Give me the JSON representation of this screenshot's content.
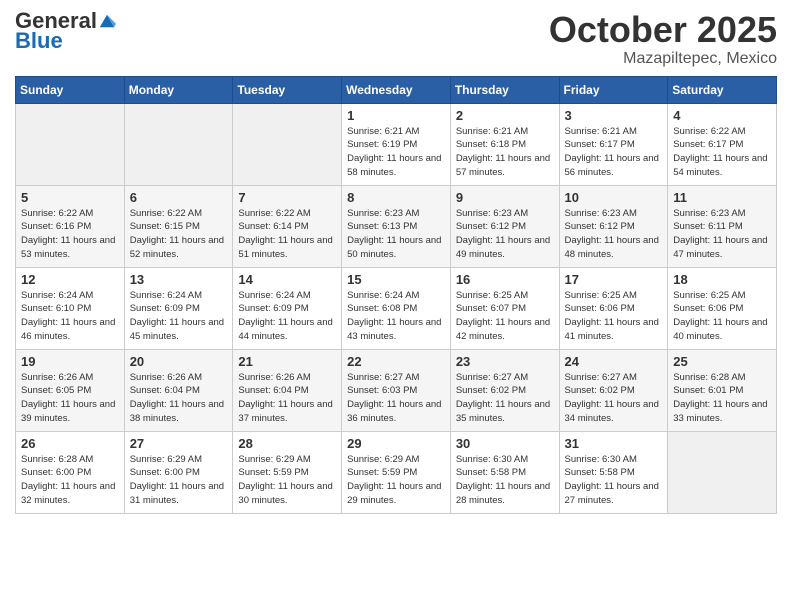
{
  "logo": {
    "general": "General",
    "blue": "Blue"
  },
  "header": {
    "month": "October 2025",
    "location": "Mazapiltepec, Mexico"
  },
  "weekdays": [
    "Sunday",
    "Monday",
    "Tuesday",
    "Wednesday",
    "Thursday",
    "Friday",
    "Saturday"
  ],
  "weeks": [
    [
      {
        "day": "",
        "sunrise": "",
        "sunset": "",
        "daylight": ""
      },
      {
        "day": "",
        "sunrise": "",
        "sunset": "",
        "daylight": ""
      },
      {
        "day": "",
        "sunrise": "",
        "sunset": "",
        "daylight": ""
      },
      {
        "day": "1",
        "sunrise": "Sunrise: 6:21 AM",
        "sunset": "Sunset: 6:19 PM",
        "daylight": "Daylight: 11 hours and 58 minutes."
      },
      {
        "day": "2",
        "sunrise": "Sunrise: 6:21 AM",
        "sunset": "Sunset: 6:18 PM",
        "daylight": "Daylight: 11 hours and 57 minutes."
      },
      {
        "day": "3",
        "sunrise": "Sunrise: 6:21 AM",
        "sunset": "Sunset: 6:17 PM",
        "daylight": "Daylight: 11 hours and 56 minutes."
      },
      {
        "day": "4",
        "sunrise": "Sunrise: 6:22 AM",
        "sunset": "Sunset: 6:17 PM",
        "daylight": "Daylight: 11 hours and 54 minutes."
      }
    ],
    [
      {
        "day": "5",
        "sunrise": "Sunrise: 6:22 AM",
        "sunset": "Sunset: 6:16 PM",
        "daylight": "Daylight: 11 hours and 53 minutes."
      },
      {
        "day": "6",
        "sunrise": "Sunrise: 6:22 AM",
        "sunset": "Sunset: 6:15 PM",
        "daylight": "Daylight: 11 hours and 52 minutes."
      },
      {
        "day": "7",
        "sunrise": "Sunrise: 6:22 AM",
        "sunset": "Sunset: 6:14 PM",
        "daylight": "Daylight: 11 hours and 51 minutes."
      },
      {
        "day": "8",
        "sunrise": "Sunrise: 6:23 AM",
        "sunset": "Sunset: 6:13 PM",
        "daylight": "Daylight: 11 hours and 50 minutes."
      },
      {
        "day": "9",
        "sunrise": "Sunrise: 6:23 AM",
        "sunset": "Sunset: 6:12 PM",
        "daylight": "Daylight: 11 hours and 49 minutes."
      },
      {
        "day": "10",
        "sunrise": "Sunrise: 6:23 AM",
        "sunset": "Sunset: 6:12 PM",
        "daylight": "Daylight: 11 hours and 48 minutes."
      },
      {
        "day": "11",
        "sunrise": "Sunrise: 6:23 AM",
        "sunset": "Sunset: 6:11 PM",
        "daylight": "Daylight: 11 hours and 47 minutes."
      }
    ],
    [
      {
        "day": "12",
        "sunrise": "Sunrise: 6:24 AM",
        "sunset": "Sunset: 6:10 PM",
        "daylight": "Daylight: 11 hours and 46 minutes."
      },
      {
        "day": "13",
        "sunrise": "Sunrise: 6:24 AM",
        "sunset": "Sunset: 6:09 PM",
        "daylight": "Daylight: 11 hours and 45 minutes."
      },
      {
        "day": "14",
        "sunrise": "Sunrise: 6:24 AM",
        "sunset": "Sunset: 6:09 PM",
        "daylight": "Daylight: 11 hours and 44 minutes."
      },
      {
        "day": "15",
        "sunrise": "Sunrise: 6:24 AM",
        "sunset": "Sunset: 6:08 PM",
        "daylight": "Daylight: 11 hours and 43 minutes."
      },
      {
        "day": "16",
        "sunrise": "Sunrise: 6:25 AM",
        "sunset": "Sunset: 6:07 PM",
        "daylight": "Daylight: 11 hours and 42 minutes."
      },
      {
        "day": "17",
        "sunrise": "Sunrise: 6:25 AM",
        "sunset": "Sunset: 6:06 PM",
        "daylight": "Daylight: 11 hours and 41 minutes."
      },
      {
        "day": "18",
        "sunrise": "Sunrise: 6:25 AM",
        "sunset": "Sunset: 6:06 PM",
        "daylight": "Daylight: 11 hours and 40 minutes."
      }
    ],
    [
      {
        "day": "19",
        "sunrise": "Sunrise: 6:26 AM",
        "sunset": "Sunset: 6:05 PM",
        "daylight": "Daylight: 11 hours and 39 minutes."
      },
      {
        "day": "20",
        "sunrise": "Sunrise: 6:26 AM",
        "sunset": "Sunset: 6:04 PM",
        "daylight": "Daylight: 11 hours and 38 minutes."
      },
      {
        "day": "21",
        "sunrise": "Sunrise: 6:26 AM",
        "sunset": "Sunset: 6:04 PM",
        "daylight": "Daylight: 11 hours and 37 minutes."
      },
      {
        "day": "22",
        "sunrise": "Sunrise: 6:27 AM",
        "sunset": "Sunset: 6:03 PM",
        "daylight": "Daylight: 11 hours and 36 minutes."
      },
      {
        "day": "23",
        "sunrise": "Sunrise: 6:27 AM",
        "sunset": "Sunset: 6:02 PM",
        "daylight": "Daylight: 11 hours and 35 minutes."
      },
      {
        "day": "24",
        "sunrise": "Sunrise: 6:27 AM",
        "sunset": "Sunset: 6:02 PM",
        "daylight": "Daylight: 11 hours and 34 minutes."
      },
      {
        "day": "25",
        "sunrise": "Sunrise: 6:28 AM",
        "sunset": "Sunset: 6:01 PM",
        "daylight": "Daylight: 11 hours and 33 minutes."
      }
    ],
    [
      {
        "day": "26",
        "sunrise": "Sunrise: 6:28 AM",
        "sunset": "Sunset: 6:00 PM",
        "daylight": "Daylight: 11 hours and 32 minutes."
      },
      {
        "day": "27",
        "sunrise": "Sunrise: 6:29 AM",
        "sunset": "Sunset: 6:00 PM",
        "daylight": "Daylight: 11 hours and 31 minutes."
      },
      {
        "day": "28",
        "sunrise": "Sunrise: 6:29 AM",
        "sunset": "Sunset: 5:59 PM",
        "daylight": "Daylight: 11 hours and 30 minutes."
      },
      {
        "day": "29",
        "sunrise": "Sunrise: 6:29 AM",
        "sunset": "Sunset: 5:59 PM",
        "daylight": "Daylight: 11 hours and 29 minutes."
      },
      {
        "day": "30",
        "sunrise": "Sunrise: 6:30 AM",
        "sunset": "Sunset: 5:58 PM",
        "daylight": "Daylight: 11 hours and 28 minutes."
      },
      {
        "day": "31",
        "sunrise": "Sunrise: 6:30 AM",
        "sunset": "Sunset: 5:58 PM",
        "daylight": "Daylight: 11 hours and 27 minutes."
      },
      {
        "day": "",
        "sunrise": "",
        "sunset": "",
        "daylight": ""
      }
    ]
  ]
}
